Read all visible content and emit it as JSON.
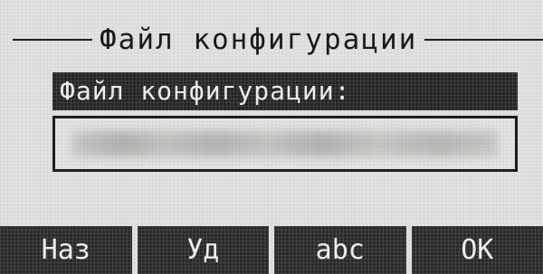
{
  "header": {
    "title": "Файл конфигурации"
  },
  "field": {
    "label": "Файл конфигурации:",
    "value": ""
  },
  "softkeys": [
    {
      "label": "Наз"
    },
    {
      "label": "Уд"
    },
    {
      "label": "abc"
    },
    {
      "label": "OK"
    }
  ]
}
